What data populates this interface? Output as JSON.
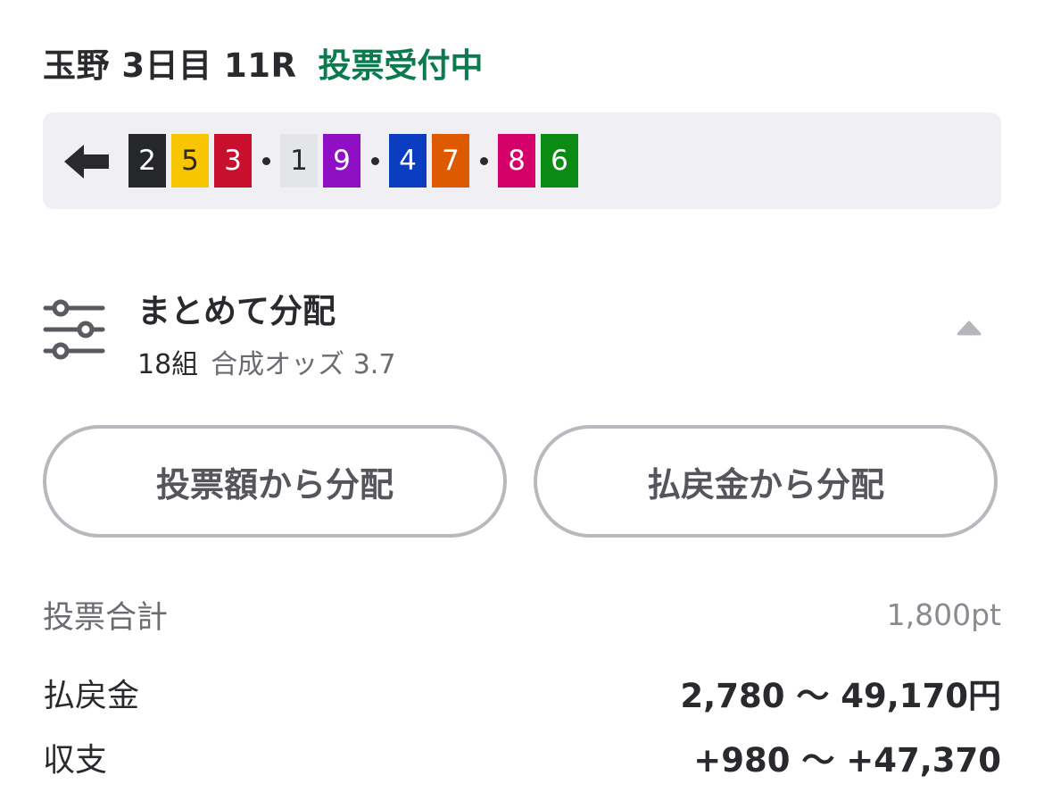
{
  "header": {
    "race_title": "玉野 3日目 11R",
    "status": "投票受付中",
    "status_color": "#0b7a4e"
  },
  "selection": {
    "back_icon": "back-arrow-icon",
    "groups": [
      [
        {
          "num": "2",
          "bg": "#26272b",
          "fg": "#ffffff"
        },
        {
          "num": "5",
          "bg": "#f7c600",
          "fg": "#2a2a2e"
        },
        {
          "num": "3",
          "bg": "#c8102e",
          "fg": "#ffffff"
        }
      ],
      [
        {
          "num": "1",
          "bg": "#e4e5e8",
          "fg": "#2a2a2e"
        },
        {
          "num": "9",
          "bg": "#8f10c4",
          "fg": "#ffffff"
        }
      ],
      [
        {
          "num": "4",
          "bg": "#0a3dbf",
          "fg": "#ffffff"
        },
        {
          "num": "7",
          "bg": "#de5a00",
          "fg": "#ffffff"
        }
      ],
      [
        {
          "num": "8",
          "bg": "#d6006a",
          "fg": "#ffffff"
        },
        {
          "num": "6",
          "bg": "#0b8a14",
          "fg": "#ffffff"
        }
      ]
    ]
  },
  "summary": {
    "icon": "sliders-icon",
    "title": "まとめて分配",
    "combos": "18組",
    "odds": "合成オッズ 3.7",
    "toggle_icon": "chevron-up-icon"
  },
  "buttons": {
    "by_bet": "投票額から分配",
    "by_payout": "払戻金から分配"
  },
  "totals": {
    "bet_label": "投票合計",
    "bet_value": "1,800pt",
    "payout_label": "払戻金",
    "payout_value": "2,780 〜 49,170円",
    "balance_label": "収支",
    "balance_value": "+980 〜 +47,370"
  }
}
